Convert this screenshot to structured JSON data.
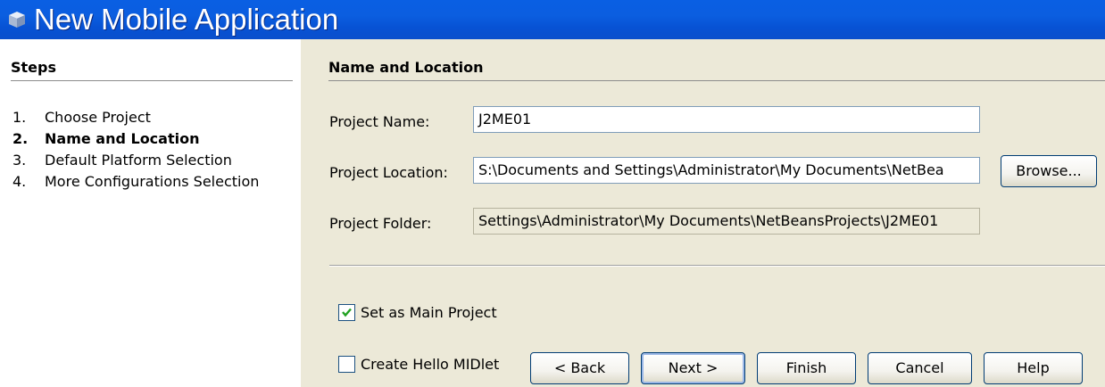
{
  "window": {
    "title": "New Mobile Application",
    "icon": "netbeans-cube-icon"
  },
  "steps": {
    "heading": "Steps",
    "items": [
      {
        "num": "1.",
        "label": "Choose Project"
      },
      {
        "num": "2.",
        "label": "Name and Location",
        "current": true
      },
      {
        "num": "3.",
        "label": "Default Platform Selection"
      },
      {
        "num": "4.",
        "label": "More Configurations Selection"
      }
    ]
  },
  "main": {
    "heading": "Name and Location",
    "project_name": {
      "label": "Project Name:",
      "value": "J2ME01"
    },
    "project_location": {
      "label": "Project Location:",
      "value": "S:\\Documents and Settings\\Administrator\\My Documents\\NetBea"
    },
    "project_folder": {
      "label": "Project Folder:",
      "value": "Settings\\Administrator\\My Documents\\NetBeansProjects\\J2ME01"
    },
    "browse_label": "Browse...",
    "set_main_project": {
      "label": "Set as Main Project",
      "checked": true
    },
    "create_hello_midlet": {
      "label": "Create Hello MIDlet",
      "checked": false
    }
  },
  "buttons": {
    "back": "< Back",
    "next": "Next >",
    "finish": "Finish",
    "cancel": "Cancel",
    "help": "Help"
  },
  "colors": {
    "titlebar": "#0a5fe3",
    "dialog_bg": "#ece9d8",
    "steps_bg": "#ffffff",
    "check_green": "#21a121"
  }
}
